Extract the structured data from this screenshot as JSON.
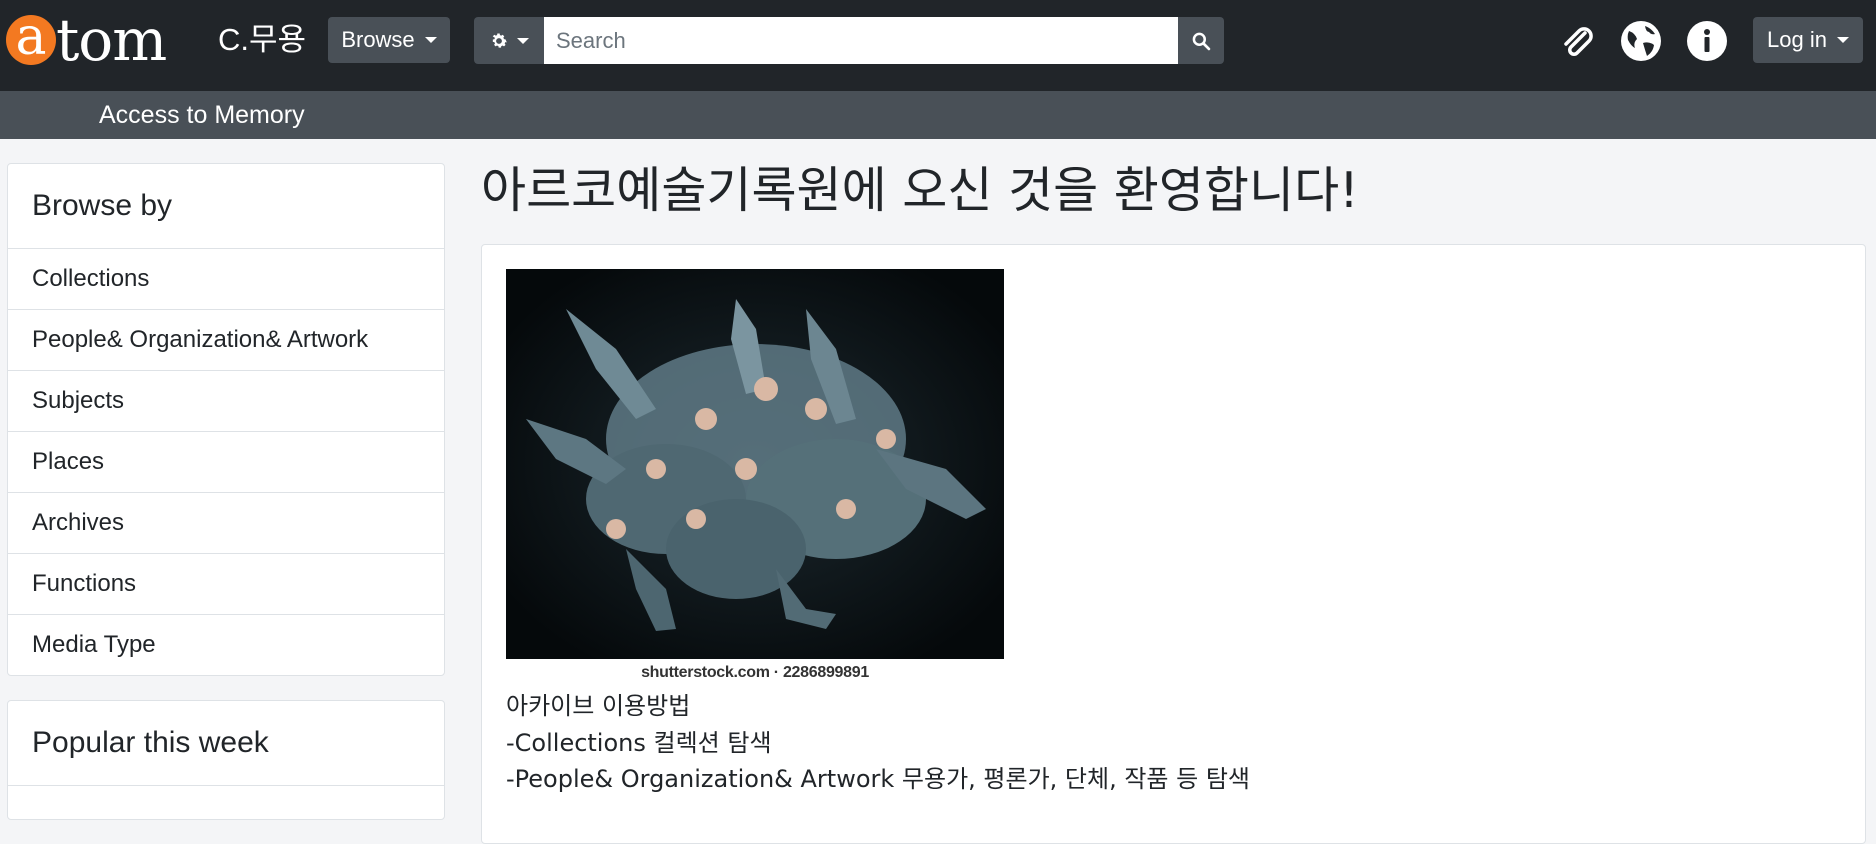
{
  "header": {
    "logo_a": "a",
    "logo_rest": "tom",
    "site_name": "C.무용",
    "browse_label": "Browse",
    "search_placeholder": "Search",
    "login_label": "Log in",
    "subtitle": "Access to Memory"
  },
  "sidebar": {
    "title": "Browse by",
    "items": [
      {
        "label": "Collections"
      },
      {
        "label": "People& Organization& Artwork"
      },
      {
        "label": "Subjects"
      },
      {
        "label": "Places"
      },
      {
        "label": "Archives"
      },
      {
        "label": "Functions"
      },
      {
        "label": "Media Type"
      }
    ]
  },
  "popular": {
    "title": "Popular this week"
  },
  "main": {
    "title": "아르코예술기록원에 오신 것을 환영합니다!",
    "image_caption": "shutterstock.com · 2286899891",
    "lines": [
      "아카이브 이용방법",
      "-Collections 컬렉션 탐색",
      "-People& Organization& Artwork 무용가, 평론가, 단체, 작품 등 탐색"
    ]
  },
  "colors": {
    "topbar": "#212529",
    "subbar": "#495057",
    "logo_accent": "#f37921"
  }
}
